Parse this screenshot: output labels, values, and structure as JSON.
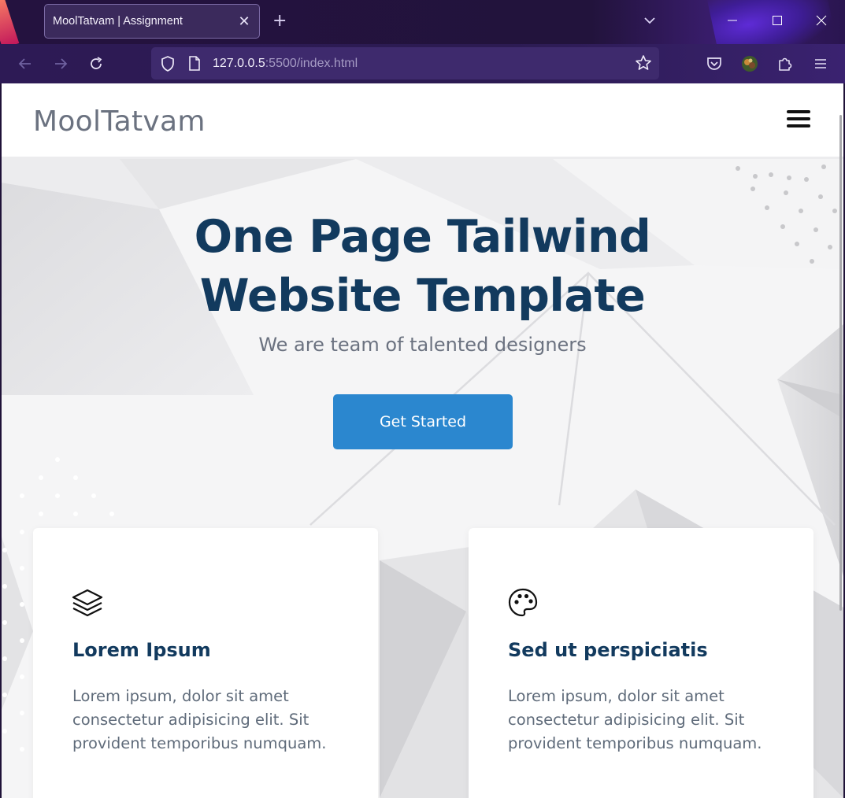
{
  "browser": {
    "tab_title": "MoolTatvam | Assignment",
    "url_host": "127.0.0.5",
    "url_path": ":5500/index.html"
  },
  "site": {
    "logo": "MoolTatvam",
    "hero": {
      "title_line1": "One Page Tailwind",
      "title_line2": "Website Template",
      "subtitle": "We are team of talented designers",
      "cta_label": "Get Started"
    },
    "cards": [
      {
        "icon": "layers-icon",
        "title": "Lorem Ipsum",
        "text": "Lorem ipsum, dolor sit amet consectetur adipisicing elit. Sit provident temporibus numquam."
      },
      {
        "icon": "palette-icon",
        "title": "Sed ut perspiciatis",
        "text": "Lorem ipsum, dolor sit amet consectetur adipisicing elit. Sit provident temporibus numquam."
      }
    ]
  },
  "colors": {
    "heading": "#123a5e",
    "button": "#2b87cf",
    "muted_text": "#6b7280"
  }
}
